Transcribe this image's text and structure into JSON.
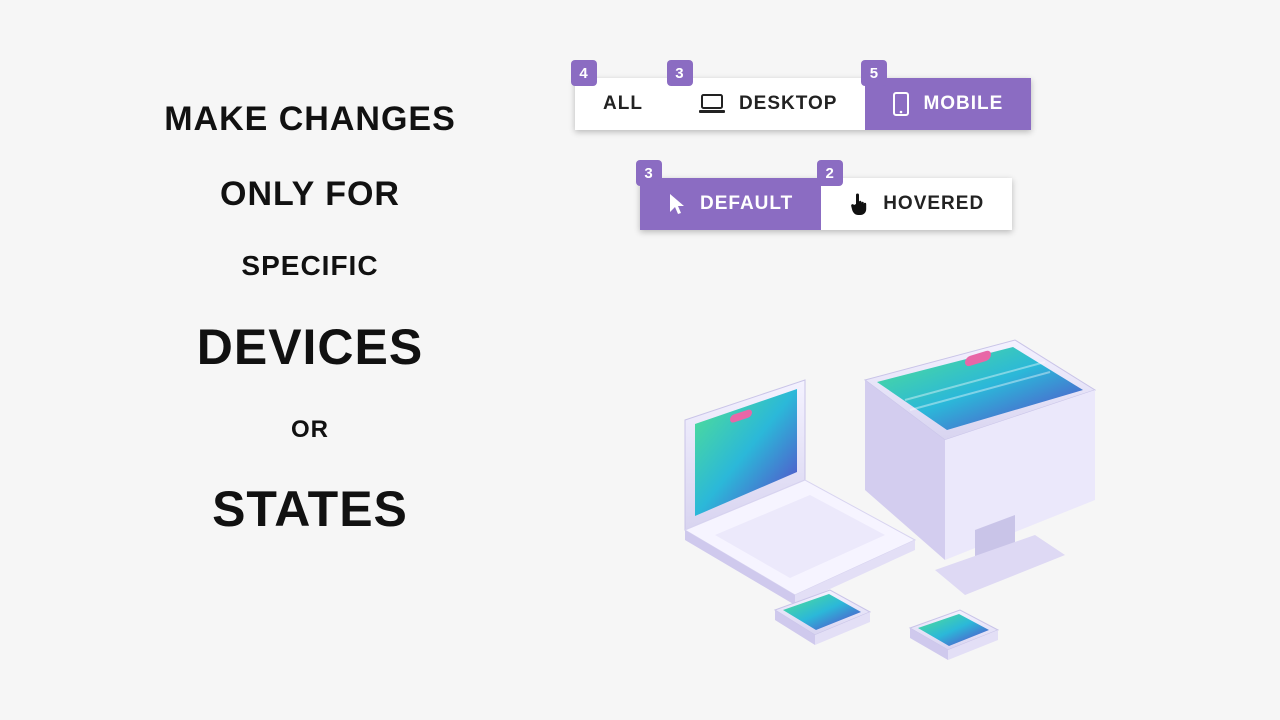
{
  "copy": {
    "line1": "MAKE CHANGES",
    "line2": "ONLY FOR",
    "line3": "SPECIFIC",
    "line4": "DEVICES",
    "line5": "OR",
    "line6": "STATES"
  },
  "devices": {
    "all": {
      "label": "ALL",
      "badge": "4",
      "active": false
    },
    "desktop": {
      "label": "DESKTOP",
      "badge": "3",
      "active": false
    },
    "mobile": {
      "label": "MOBILE",
      "badge": "5",
      "active": true
    }
  },
  "states": {
    "default": {
      "label": "DEFAULT",
      "badge": "3",
      "active": true
    },
    "hovered": {
      "label": "HOVERED",
      "badge": "2",
      "active": false
    }
  },
  "colors": {
    "accent": "#8b6cc2",
    "bg": "#f6f6f6"
  }
}
